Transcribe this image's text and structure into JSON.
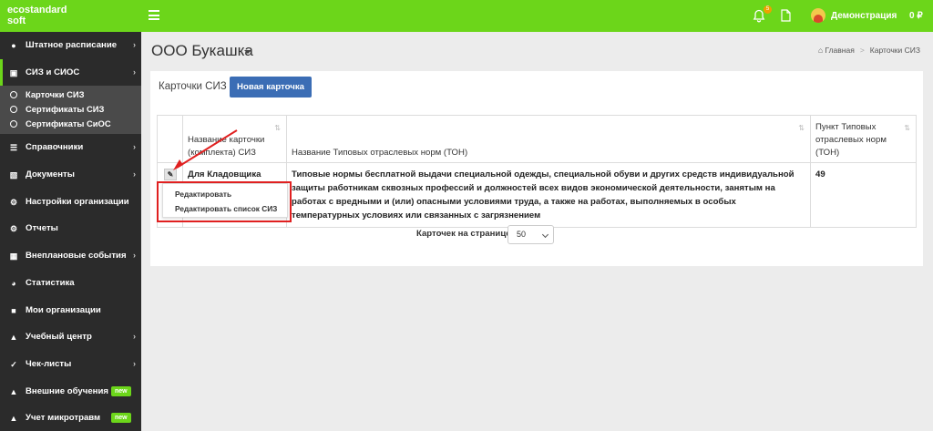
{
  "brand": {
    "line1": "ecostandard",
    "line2": "soft"
  },
  "topbar": {
    "notification_count": "5",
    "user": "Демонстрация",
    "balance": "0 ₽"
  },
  "sidebar": {
    "items": [
      {
        "label": "Штатное расписание",
        "icon": "users-icon",
        "has_arrow": true
      },
      {
        "label": "СИЗ и СИОС",
        "icon": "briefcase-icon",
        "has_arrow": true,
        "active": true
      },
      {
        "label": "Справочники",
        "icon": "list-icon",
        "has_arrow": true
      },
      {
        "label": "Документы",
        "icon": "columns-icon",
        "has_arrow": true
      },
      {
        "label": "Настройки организации",
        "icon": "gear-icon",
        "has_arrow": false
      },
      {
        "label": "Отчеты",
        "icon": "cog-icon",
        "has_arrow": false
      },
      {
        "label": "Внеплановые события",
        "icon": "calendar-icon",
        "has_arrow": true
      },
      {
        "label": "Статистика",
        "icon": "pie-chart-icon",
        "has_arrow": false
      },
      {
        "label": "Мои организации",
        "icon": "suitcase-icon",
        "has_arrow": false
      },
      {
        "label": "Учебный центр",
        "icon": "graduation-cap-icon",
        "has_arrow": true
      },
      {
        "label": "Чек-листы",
        "icon": "check-icon",
        "has_arrow": true
      },
      {
        "label": "Внешние обучения",
        "icon": "graduation-cap-icon",
        "has_arrow": false,
        "badge": "new"
      },
      {
        "label": "Учет микротравм",
        "icon": "graduation-cap-icon",
        "has_arrow": false,
        "badge": "new"
      }
    ],
    "subitems": [
      {
        "label": "Карточки СИЗ"
      },
      {
        "label": "Сертификаты СИЗ"
      },
      {
        "label": "Сертификаты СиОС"
      }
    ]
  },
  "page": {
    "title": "ООО Букашка"
  },
  "breadcrumb": {
    "home": "Главная",
    "current": "Карточки СИЗ"
  },
  "card": {
    "title": "Карточки СИЗ",
    "new_button": "Новая карточка"
  },
  "table": {
    "headers": [
      "",
      "Название карточки (комплекта) СИЗ",
      "Название Типовых отраслевых норм (ТОН)",
      "Пункт Типовых отраслевых норм (ТОН)"
    ],
    "rows": [
      {
        "name": "Для Кладовщика",
        "ton": "Типовые нормы бесплатной выдачи специальной одежды, специальной обуви и других средств индивидуальной защиты работникам сквозных профессий и должностей всех видов экономической деятельности, занятым на работах с вредными и (или) опасными условиями труда, а также на работах, выполняемых в особых температурных условиях или связанных с загрязнением",
        "point": "49"
      }
    ]
  },
  "dropdown": {
    "items": [
      "Редактировать",
      "Редактировать список СИЗ"
    ]
  },
  "pagination": {
    "label": "Карточек на странице",
    "value": "50"
  },
  "colors": {
    "accent": "#6cd61a",
    "sidebar": "#2b2b2b",
    "button": "#3b6db5",
    "highlight": "#e02020"
  }
}
